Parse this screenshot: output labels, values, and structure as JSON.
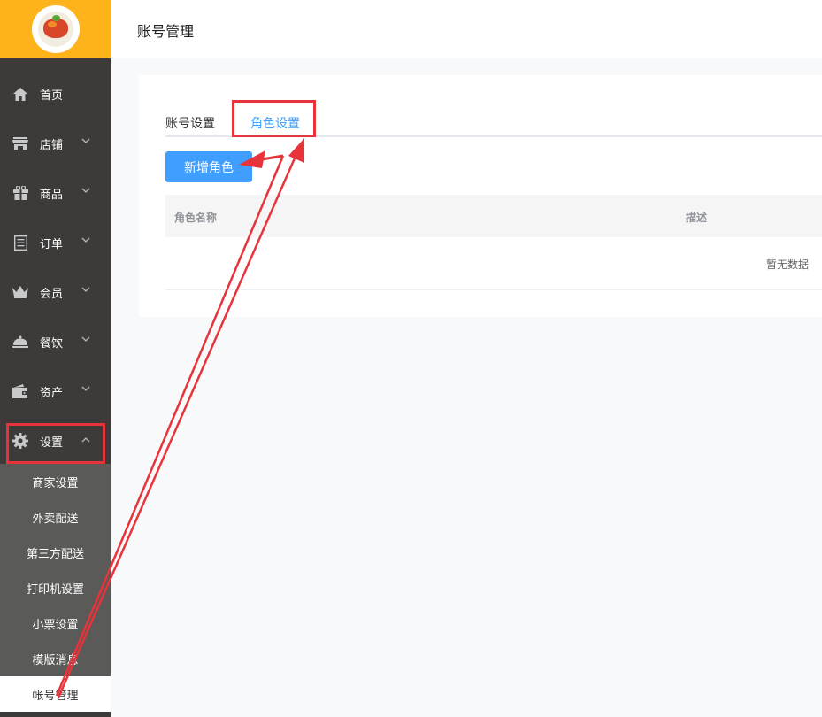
{
  "header": {
    "title": "账号管理"
  },
  "sidebar": {
    "items": [
      {
        "label": "首页",
        "icon": "home-icon",
        "has_chevron": false
      },
      {
        "label": "店铺",
        "icon": "store-icon",
        "has_chevron": true
      },
      {
        "label": "商品",
        "icon": "gift-icon",
        "has_chevron": true
      },
      {
        "label": "订单",
        "icon": "order-list-icon",
        "has_chevron": true
      },
      {
        "label": "会员",
        "icon": "crown-icon",
        "has_chevron": true
      },
      {
        "label": "餐饮",
        "icon": "cloche-icon",
        "has_chevron": true
      },
      {
        "label": "资产",
        "icon": "wallet-icon",
        "has_chevron": true
      },
      {
        "label": "设置",
        "icon": "gear-icon",
        "has_chevron": true,
        "expanded": true
      }
    ],
    "submenu": [
      {
        "label": "商家设置"
      },
      {
        "label": "外卖配送"
      },
      {
        "label": "第三方配送"
      },
      {
        "label": "打印机设置"
      },
      {
        "label": "小票设置"
      },
      {
        "label": "模版消息"
      },
      {
        "label": "帐号管理",
        "active": true
      }
    ]
  },
  "tabs": [
    {
      "label": "账号设置",
      "active": false
    },
    {
      "label": "角色设置",
      "active": true
    }
  ],
  "actions": {
    "add_role_label": "新增角色"
  },
  "table": {
    "columns": [
      "角色名称",
      "描述"
    ],
    "empty_text": "暂无数据"
  },
  "colors": {
    "sidebar_bg": "#3c3b39",
    "logo_bg": "#ffb31a",
    "submenu_bg": "#5a5a58",
    "primary": "#409eff",
    "annotation": "#e8333a"
  }
}
